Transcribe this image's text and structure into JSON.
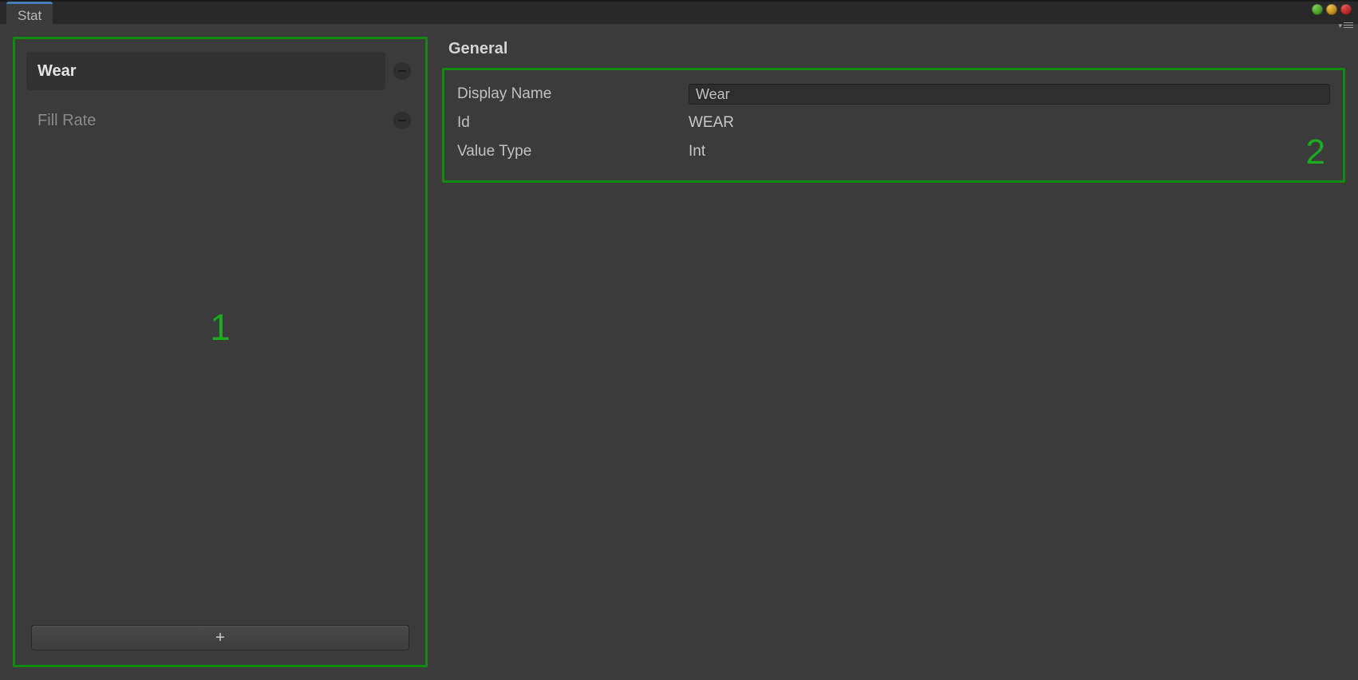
{
  "tab": {
    "label": "Stat"
  },
  "annotations": {
    "left": "1",
    "right": "2"
  },
  "stats": {
    "items": [
      {
        "label": "Wear",
        "selected": true
      },
      {
        "label": "Fill Rate",
        "selected": false
      }
    ],
    "add_button_label": "+"
  },
  "details": {
    "section_title": "General",
    "fields": {
      "display_name": {
        "label": "Display Name",
        "value": "Wear"
      },
      "id": {
        "label": "Id",
        "value": "WEAR"
      },
      "value_type": {
        "label": "Value Type",
        "value": "Int"
      }
    }
  }
}
